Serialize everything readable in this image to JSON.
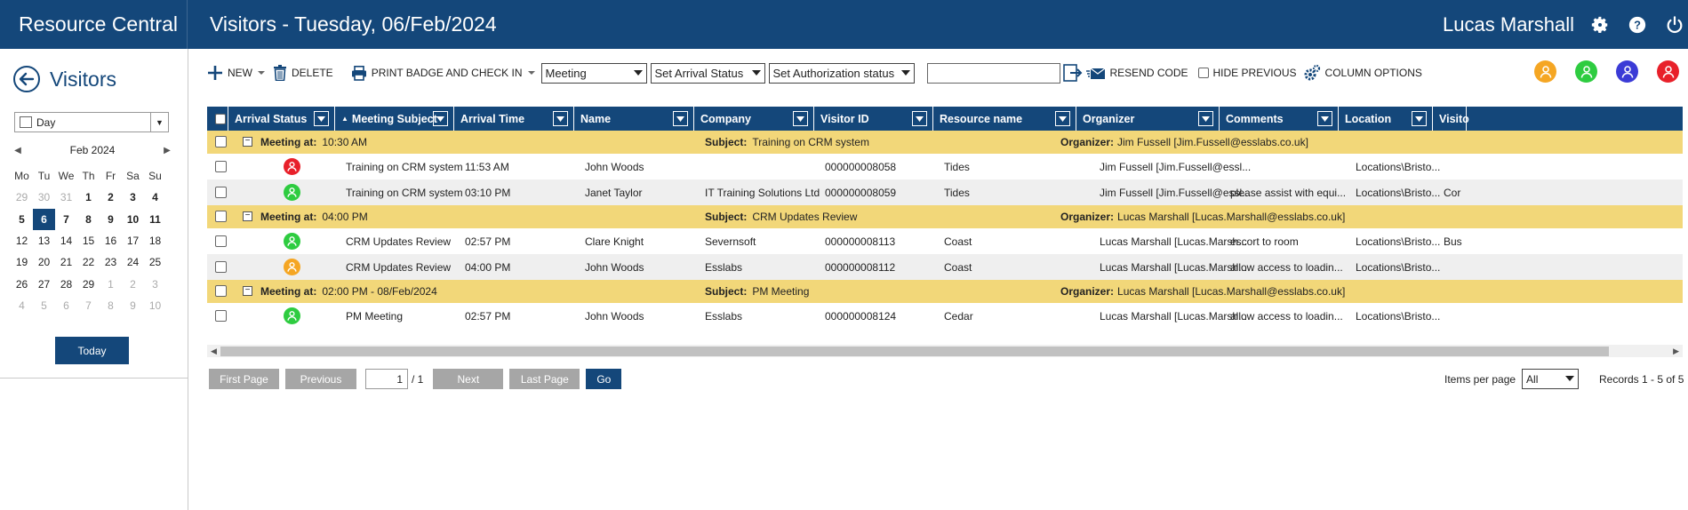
{
  "header": {
    "brand": "Resource Central",
    "title": "Visitors - Tuesday, 06/Feb/2024",
    "user": "Lucas Marshall"
  },
  "left": {
    "back_label": "Visitors",
    "view": "Day",
    "calendar": {
      "month": "Feb 2024",
      "weekdays": [
        "Mo",
        "Tu",
        "We",
        "Th",
        "Fr",
        "Sa",
        "Su"
      ],
      "weeks": [
        [
          "29",
          "30",
          "31",
          "1",
          "2",
          "3",
          "4"
        ],
        [
          "5",
          "6",
          "7",
          "8",
          "9",
          "10",
          "11"
        ],
        [
          "12",
          "13",
          "14",
          "15",
          "16",
          "17",
          "18"
        ],
        [
          "19",
          "20",
          "21",
          "22",
          "23",
          "24",
          "25"
        ],
        [
          "26",
          "27",
          "28",
          "29",
          "1",
          "2",
          "3"
        ],
        [
          "4",
          "5",
          "6",
          "7",
          "8",
          "9",
          "10"
        ]
      ],
      "selected": "6"
    },
    "today_label": "Today"
  },
  "toolbar": {
    "new_label": "NEW",
    "delete_label": "DELETE",
    "print_label": "PRINT BADGE AND CHECK IN",
    "filter_type": "Meeting",
    "arrival_status": "Set Arrival Status",
    "auth_status": "Set Authorization status",
    "search_value": "",
    "resend_label": "RESEND CODE",
    "hide_previous_label": "HIDE PREVIOUS",
    "column_options_label": "COLUMN OPTIONS"
  },
  "status_colors": {
    "orange": "#f5a623",
    "green": "#2ecc40",
    "blue": "#3b3bd6",
    "red": "#e8202a"
  },
  "grid": {
    "columns": [
      "Arrival Status",
      "Meeting Subject",
      "Arrival Time",
      "Name",
      "Company",
      "Visitor ID",
      "Resource name",
      "Organizer",
      "Comments",
      "Location",
      "Visito"
    ],
    "labels": {
      "meeting_at": "Meeting at:",
      "subject": "Subject:",
      "organizer": "Organizer:"
    },
    "groups": [
      {
        "time": "10:30 AM",
        "subject": "Training on CRM system",
        "organizer": "Jim Fussell [Jim.Fussell@esslabs.co.uk]",
        "rows": [
          {
            "status": "red",
            "subject": "Training on CRM system",
            "time": "11:53 AM",
            "name": "John Woods",
            "company": "",
            "visitor_id": "000000008058",
            "resource": "Tides",
            "organizer": "Jim Fussell [Jim.Fussell@essl...",
            "comments": "",
            "location": "Locations\\Bristo...",
            "visitor": ""
          },
          {
            "status": "green",
            "subject": "Training on CRM system",
            "time": "03:10 PM",
            "name": "Janet Taylor",
            "company": "IT Training Solutions Ltd",
            "visitor_id": "000000008059",
            "resource": "Tides",
            "organizer": "Jim Fussell [Jim.Fussell@essl...",
            "comments": "please assist with equi...",
            "location": "Locations\\Bristo...",
            "visitor": "Cor"
          }
        ]
      },
      {
        "time": "04:00 PM",
        "subject": "CRM Updates Review",
        "organizer": "Lucas Marshall [Lucas.Marshall@esslabs.co.uk]",
        "rows": [
          {
            "status": "green",
            "subject": "CRM Updates Review",
            "time": "02:57 PM",
            "name": "Clare Knight",
            "company": "Severnsoft",
            "visitor_id": "000000008113",
            "resource": "Coast",
            "organizer": "Lucas Marshall [Lucas.Marsh...",
            "comments": "escort to room",
            "location": "Locations\\Bristo...",
            "visitor": "Bus"
          },
          {
            "status": "orange",
            "subject": "CRM Updates Review",
            "time": "04:00 PM",
            "name": "John Woods",
            "company": "Esslabs",
            "visitor_id": "000000008112",
            "resource": "Coast",
            "organizer": "Lucas Marshall [Lucas.Marsh...",
            "comments": "allow access to loadin...",
            "location": "Locations\\Bristo...",
            "visitor": ""
          }
        ]
      },
      {
        "time": "02:00 PM - 08/Feb/2024",
        "subject": "PM Meeting",
        "organizer": "Lucas Marshall [Lucas.Marshall@esslabs.co.uk]",
        "rows": [
          {
            "status": "green",
            "subject": "PM Meeting",
            "time": "02:57 PM",
            "name": "John Woods",
            "company": "Esslabs",
            "visitor_id": "000000008124",
            "resource": "Cedar",
            "organizer": "Lucas Marshall [Lucas.Marsh...",
            "comments": "allow access to loadin...",
            "location": "Locations\\Bristo...",
            "visitor": ""
          }
        ]
      }
    ]
  },
  "pager": {
    "first": "First Page",
    "previous": "Previous",
    "page": "1",
    "of": "/ 1",
    "next": "Next",
    "last": "Last Page",
    "go": "Go",
    "items_per_page_label": "Items per page",
    "items_per_page": "All",
    "records": "Records 1 - 5 of 5"
  }
}
